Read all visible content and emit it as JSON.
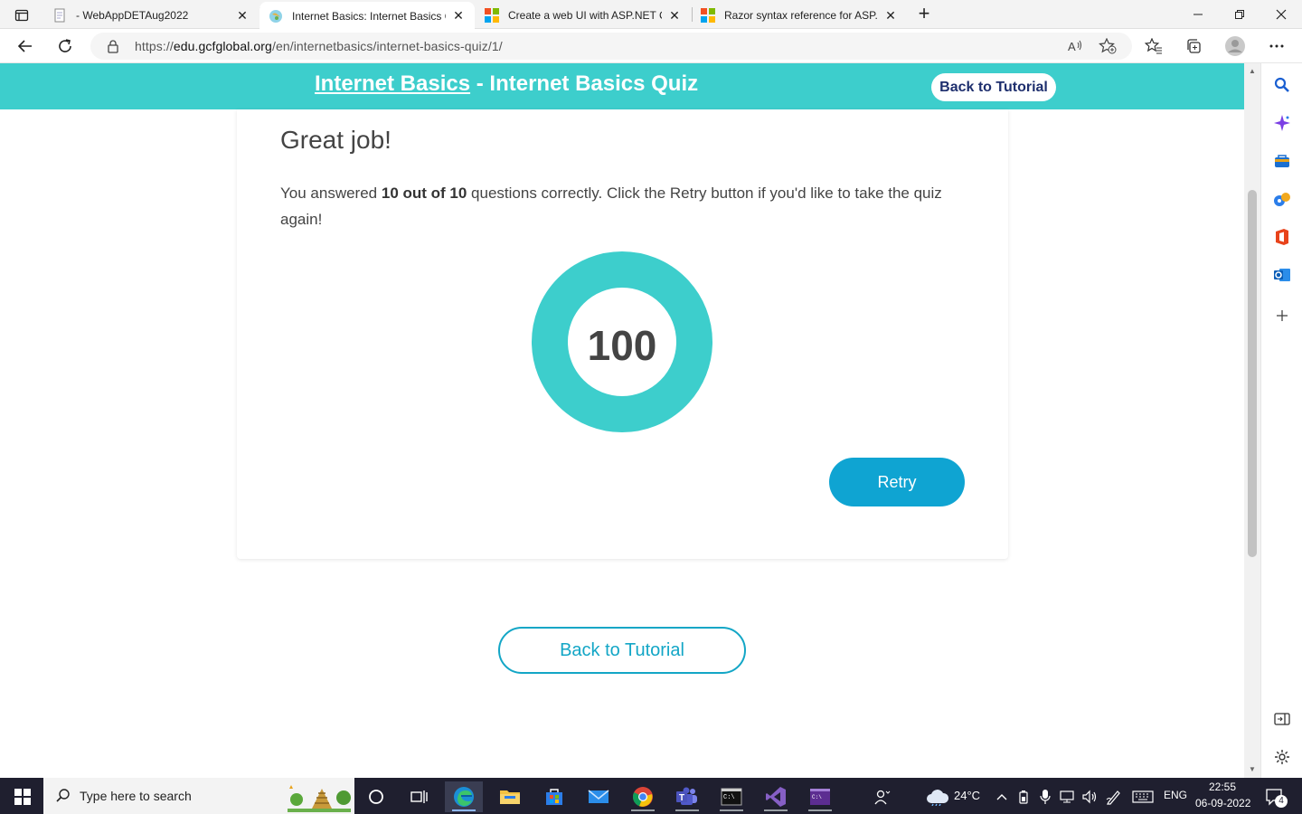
{
  "browser": {
    "tabs": [
      {
        "title": "- WebAppDETAug2022",
        "active": false,
        "favicon": "doc-icon"
      },
      {
        "title": "Internet Basics: Internet Basics Q",
        "active": true,
        "favicon": "gcf-globe-icon"
      },
      {
        "title": "Create a web UI with ASP.NET Co",
        "active": false,
        "favicon": "microsoft-icon"
      },
      {
        "title": "Razor syntax reference for ASP.N",
        "active": false,
        "favicon": "microsoft-icon"
      }
    ],
    "new_tab": "+",
    "url_prefix": "https://",
    "url_domain": "edu.gcfglobal.org",
    "url_path": "/en/internetbasics/internet-basics-quiz/1/"
  },
  "header": {
    "course_link": "Internet Basics",
    "separator": " - ",
    "quiz_title": "Internet Basics Quiz",
    "back_button": "Back to Tutorial"
  },
  "result": {
    "heading": "Great job!",
    "text_before": "You answered ",
    "score_phrase": "10 out of 10",
    "text_after": " questions correctly. Click the Retry button if you'd like to take the quiz again!",
    "score": "100",
    "retry_button": "Retry",
    "accent_color": "#3dcecc"
  },
  "footer": {
    "back_button": "Back to Tutorial"
  },
  "taskbar": {
    "search_placeholder": "Type here to search",
    "weather": "24°C",
    "language": "ENG",
    "time": "22:55",
    "date": "06-09-2022",
    "notification_count": "4"
  }
}
